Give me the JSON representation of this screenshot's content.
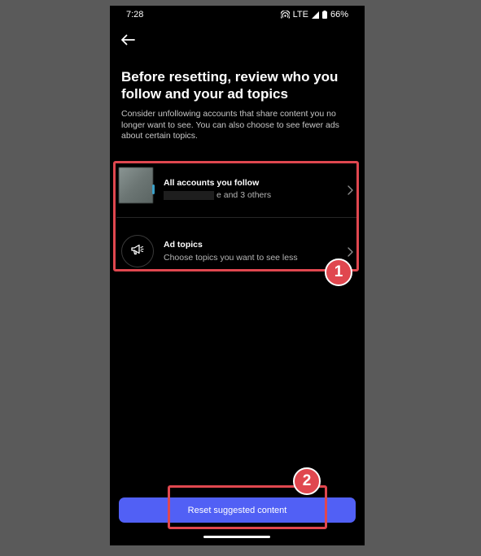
{
  "status_bar": {
    "time": "7:28",
    "network": "LTE",
    "battery": "66%",
    "icons": [
      "hotspot-icon",
      "signal-icon",
      "battery-icon"
    ]
  },
  "header": {
    "back_icon": "back-arrow-icon"
  },
  "main": {
    "title": "Before resetting, review who you follow and your ad topics",
    "description": "Consider unfollowing accounts that share content you no longer want to see. You can also choose to see fewer ads about certain topics."
  },
  "list": {
    "items": [
      {
        "title": "All accounts you follow",
        "subtitle": "e and 3 others",
        "icon": "avatar"
      },
      {
        "title": "Ad topics",
        "subtitle": "Choose topics you want to see less",
        "icon": "megaphone-icon"
      }
    ]
  },
  "footer": {
    "reset_label": "Reset suggested content"
  },
  "annotations": {
    "badge_1": "1",
    "badge_2": "2",
    "color": "#e0474f"
  },
  "colors": {
    "accent": "#5160f5",
    "background": "#000000",
    "outer_background": "#5a5a5a"
  }
}
